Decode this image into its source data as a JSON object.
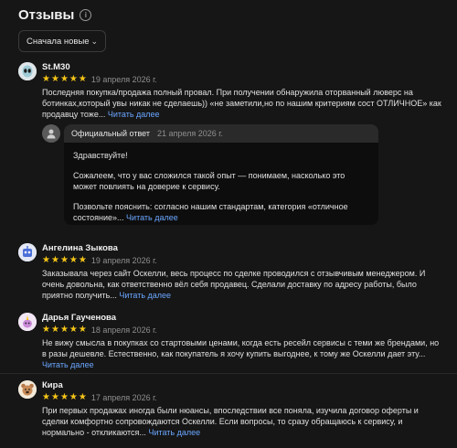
{
  "header": {
    "title": "Отзывы",
    "info_icon": "info-icon"
  },
  "sort": {
    "selected": "Сначала новые",
    "icon": "chevron-down-icon"
  },
  "more_label": "Читать далее",
  "reviews": [
    {
      "author": "St.M30",
      "rating": 5,
      "date": "19 апреля 2026 г.",
      "text": "Последняя покупка/продажа полный провал. При получении обнаружила оторванный люверс на ботинках,который увы никак не сделаешь)) «не заметили,но по нашим критериям сост ОТЛИЧНОЕ» как продавцу тоже...",
      "reply": {
        "label": "Официальный ответ",
        "date": "21 апреля 2026 г.",
        "greeting": "Здравствуйте!",
        "p1": "Сожалеем, что у вас сложился такой опыт — понимаем, насколько это может повлиять на доверие к сервису.",
        "p2": "Позвольте пояснить: согласно нашим стандартам, категория «отличное состояние»..."
      }
    },
    {
      "author": "Ангелина Зыкова",
      "rating": 5,
      "date": "19 апреля 2026 г.",
      "text": "Заказывала через сайт Оскелли, весь процесс по сделке проводился с отзывчивым менеджером. И очень довольна, как ответственно вёл себя продавец. Сделали доставку по адресу работы, было приятно получить..."
    },
    {
      "author": "Дарья Гаученова",
      "rating": 5,
      "date": "18 апреля 2026 г.",
      "text": "Не вижу смысла в покупках со стартовыми ценами, когда есть ресейл сервисы с теми же брендами, но в разы дешевле. Естественно, как покупатель я хочу купить выгоднее, к тому же Оскелли дает эту..."
    },
    {
      "author": "Кира",
      "rating": 5,
      "date": "17 апреля 2026 г.",
      "text": "При первых продажах иногда были нюансы, впоследствии все поняла, изучила договор оферты и сделки комфортно сопровождаются Оскелли. Если вопросы, то сразу обращаюсь к сервису, и нормально - откликаются..."
    }
  ],
  "colors": {
    "accent": "#6aa6ff",
    "star": "#f5c518",
    "background": "#161616"
  }
}
